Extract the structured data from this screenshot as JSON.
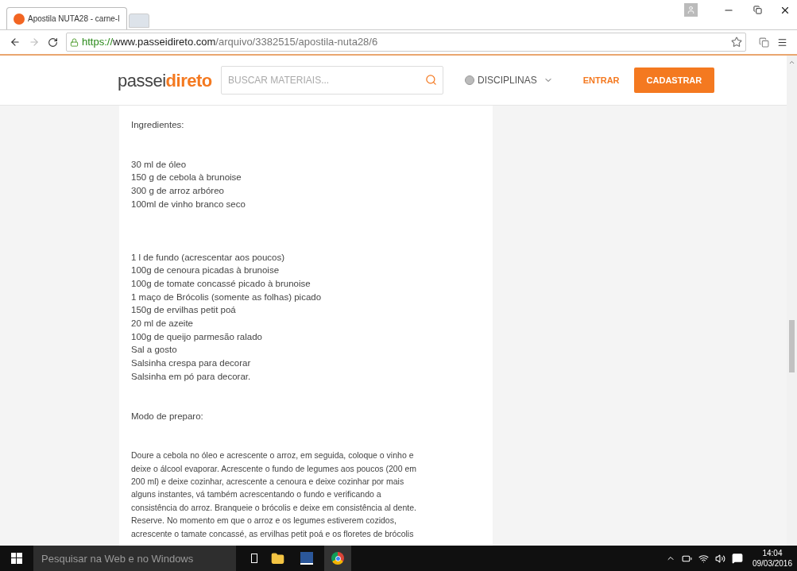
{
  "browser": {
    "tab": {
      "title": "Apostila NUTA28 - carne-l",
      "selected": true
    },
    "url": {
      "secure": "https://",
      "host": "www.passeidireto.com",
      "path": "/arquivo/3382515/apostila-nuta28/6"
    }
  },
  "site_header": {
    "logo": {
      "part_1": "passei",
      "part_2": "direto"
    },
    "search": {
      "placeholder": "BUSCAR MATERIAIS..."
    },
    "menu": "DISCIPLINAS",
    "login": "ENTRAR",
    "signup": "CADASTRAR"
  },
  "document": {
    "blocks": [
      {
        "kind": "heading",
        "text": "Ingredientes:"
      },
      {
        "kind": "list",
        "lines": [
          "30 ml de óleo",
          "150 g de cebola à brunoise",
          "300 g de arroz arbóreo",
          "100ml de vinho branco seco"
        ]
      },
      {
        "kind": "list",
        "lines": [
          "1 l de fundo (acrescentar aos poucos)",
          "100g de cenoura picadas à brunoise",
          "100g de tomate concassé picado à brunoise",
          "1 maço de Brócolis (somente as folhas) picado",
          "150g de ervilhas petit poá",
          "20 ml de azeite",
          "100g de queijo parmesão ralado",
          "Sal a gosto",
          "Salsinha crespa para decorar",
          "Salsinha em pó para decorar."
        ]
      },
      {
        "kind": "heading",
        "text": "Modo de preparo:"
      },
      {
        "kind": "paragraph",
        "text": "Doure a cebola no óleo e acrescente o arroz, em seguida, coloque o vinho e deixe o álcool evaporar. Acrescente o fundo de legumes aos poucos (200 em 200 ml) e deixe cozinhar, acrescente a cenoura e deixe cozinhar por mais alguns instantes, vá também acrescentando o fundo e verificando a consistência do arroz. Branqueie o brócolis e deixe em consistência al dente. Reserve. No momento em que o arroz e os legumes estiverem cozidos, acrescente o tamate concassé, as ervilhas petit poá e os floretes de brócolis"
      }
    ]
  },
  "taskbar": {
    "search": {
      "placeholder": "Pesquisar na Web e no Windows"
    },
    "time": "14:04",
    "date": "09/03/2016"
  }
}
